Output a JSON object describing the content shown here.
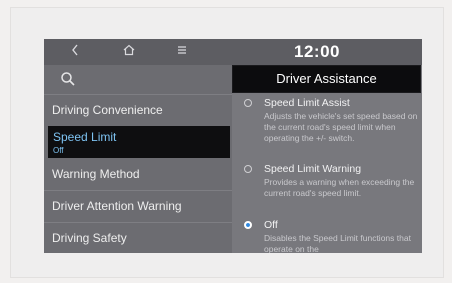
{
  "topbar": {
    "back_icon": "chevron-left-icon",
    "home_icon": "home-icon",
    "menu_icon": "menu-icon",
    "clock": "12:00"
  },
  "left_menu": {
    "search_icon": "search-icon",
    "items": [
      {
        "label": "Driving Convenience"
      },
      {
        "label": "Speed Limit",
        "sub": "Off",
        "selected": true
      },
      {
        "label": "Warning Method"
      },
      {
        "label": "Driver Attention Warning"
      },
      {
        "label": "Driving Safety"
      }
    ]
  },
  "panel": {
    "title": "Driver Assistance",
    "options": [
      {
        "title": "Speed Limit Assist",
        "desc": "Adjusts the vehicle's set speed based on the current road's speed limit when operating the +/- switch.",
        "selected": false
      },
      {
        "title": "Speed Limit Warning",
        "desc": "Provides a warning when exceeding the current road's speed limit.",
        "selected": false
      },
      {
        "title": "Off",
        "desc": "Disables the Speed Limit functions that operate on the",
        "selected": true
      }
    ]
  },
  "colors": {
    "selected_text": "#7ec3f2",
    "radio_on": "#2f89e0"
  }
}
